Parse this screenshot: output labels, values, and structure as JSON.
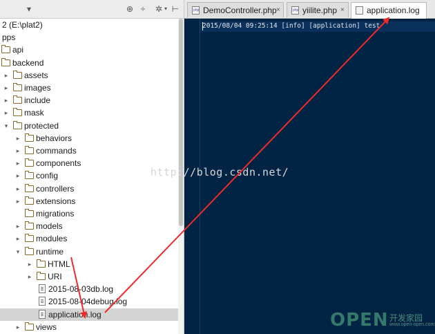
{
  "project_panel": {
    "toolbar": {
      "collapse_icon": "chevron-down-icon",
      "icons": [
        "target-icon",
        "collapse-all-icon",
        "gear-icon",
        "hide-panel-icon"
      ]
    },
    "tree": [
      {
        "label": "2 (E:\\plat2)",
        "type": "root"
      },
      {
        "label": "pps",
        "type": "text"
      },
      {
        "label": "api",
        "type": "folder"
      },
      {
        "label": "backend",
        "type": "folder"
      },
      {
        "label": "assets",
        "type": "folder"
      },
      {
        "label": "images",
        "type": "folder"
      },
      {
        "label": "include",
        "type": "folder"
      },
      {
        "label": "mask",
        "type": "folder"
      },
      {
        "label": "protected",
        "type": "folder"
      },
      {
        "label": "behaviors",
        "type": "folder"
      },
      {
        "label": "commands",
        "type": "folder"
      },
      {
        "label": "components",
        "type": "folder"
      },
      {
        "label": "config",
        "type": "folder"
      },
      {
        "label": "controllers",
        "type": "folder"
      },
      {
        "label": "extensions",
        "type": "folder"
      },
      {
        "label": "migrations",
        "type": "folder"
      },
      {
        "label": "models",
        "type": "folder"
      },
      {
        "label": "modules",
        "type": "folder"
      },
      {
        "label": "runtime",
        "type": "folder"
      },
      {
        "label": "HTML",
        "type": "folder"
      },
      {
        "label": "URI",
        "type": "folder"
      },
      {
        "label": "2015-08-03db.log",
        "type": "file"
      },
      {
        "label": "2015-08-04debug.log",
        "type": "file"
      },
      {
        "label": "application.log",
        "type": "file",
        "selected": true
      },
      {
        "label": "views",
        "type": "folder"
      }
    ]
  },
  "tabs": [
    {
      "label": "DemoController.php",
      "icon": "php-file-icon",
      "close": "×",
      "active": false
    },
    {
      "label": "yiilite.php",
      "icon": "php-file-icon",
      "close": "×",
      "active": false
    },
    {
      "label": "application.log",
      "icon": "text-file-icon",
      "close": "",
      "active": true
    }
  ],
  "editor": {
    "lines": [
      "2015/08/04 09:25:14 [info] [application] test"
    ],
    "background": "#022444"
  },
  "watermark": "http://blog.csdn.net/",
  "brand": {
    "open": "OPEN",
    "cn": "开发家园",
    "url": "www.open-open.com"
  },
  "colors": {
    "annotation_arrow": "#f02a2a",
    "selected_row": "#d4d4d4"
  }
}
